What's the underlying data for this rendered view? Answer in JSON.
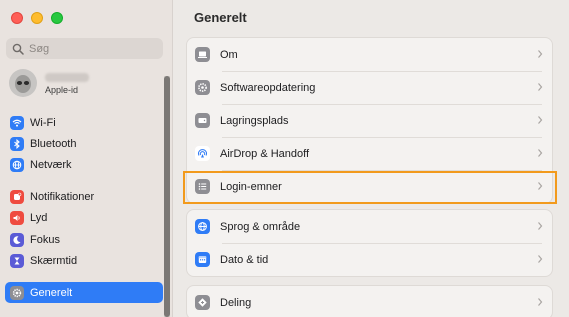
{
  "sidebar": {
    "search_placeholder": "Søg",
    "account": {
      "name": "",
      "subtitle": "Apple-id"
    },
    "items": [
      {
        "label": "Wi-Fi",
        "icon": "wifi-icon",
        "color": "#2f7cf6"
      },
      {
        "label": "Bluetooth",
        "icon": "bluetooth-icon",
        "color": "#2f7cf6"
      },
      {
        "label": "Netværk",
        "icon": "network-globe-icon",
        "color": "#2f7cf6"
      },
      {
        "label": "Notifikationer",
        "icon": "bell-icon",
        "color": "#ef4b3f"
      },
      {
        "label": "Lyd",
        "icon": "speaker-icon",
        "color": "#ef4b3f"
      },
      {
        "label": "Fokus",
        "icon": "moon-icon",
        "color": "#5b5bd6"
      },
      {
        "label": "Skærmtid",
        "icon": "hourglass-icon",
        "color": "#5b5bd6"
      },
      {
        "label": "Generelt",
        "icon": "gear-icon",
        "color": "#8e8e93",
        "selected": true
      }
    ]
  },
  "main": {
    "title": "Generelt",
    "rows": [
      {
        "label": "Om",
        "icon": "laptop-icon"
      },
      {
        "label": "Softwareopdatering",
        "icon": "gear-badge-icon"
      },
      {
        "label": "Lagringsplads",
        "icon": "storage-drive-icon"
      },
      {
        "label": "AirDrop & Handoff",
        "icon": "airdrop-icon"
      },
      {
        "label": "Login-emner",
        "icon": "list-icon",
        "highlighted": true
      },
      {
        "label": "Sprog & område",
        "icon": "globe-icon"
      },
      {
        "label": "Dato & tid",
        "icon": "calendar-icon"
      },
      {
        "label": "Deling",
        "icon": "sharing-icon"
      }
    ]
  },
  "colors": {
    "accent": "#2f7cf6",
    "highlight": "#f29a1c"
  }
}
